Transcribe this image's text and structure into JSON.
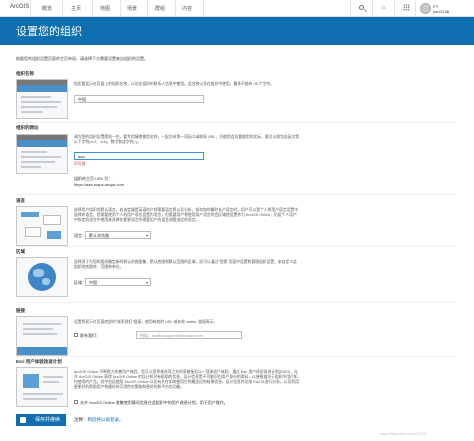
{
  "nav": {
    "logo": "ArcGIS",
    "items": [
      "概览",
      "主页",
      "地图",
      "场景",
      "群组",
      "内容"
    ],
    "user_name": "y y",
    "user_id": "yw12138"
  },
  "page_title": "设置您的组织",
  "intro": "根据您的组织设置页面的主页布局，请选择下方需要设置来自组织的设置。",
  "org_name": {
    "title": "组织名称",
    "desc": "指定要显示在页面上的组织名称，以及在组织的联系人信息中使用。此名称以及在组织中使用，最多不能有 35 个字符。",
    "value": "中国"
  },
  "org_url": {
    "title": "组织的网址",
    "desc": "请为您的组织设置简短一些，要专用情绪使用名称，一起交给第一项因义或联网 URL，仍使用会员要使用的实际，要可以保包含英文等以下字符(A-Z、a-z)，数字和连字符(-)。",
    "value": "aaa",
    "error": "不可用",
    "preview_label": "组织的主页 URL 为：",
    "preview_url": "https://aaa.maps.arcgis.com"
  },
  "language": {
    "title": "语言",
    "desc": "选择用户组织的默认语言。若选定器是英语的户将需要语言将以及分析，如何和你最时长户语言时，用户可以是个人将用户语言设置中选择的语言。您需要使用个人的用户语言设置内语言，但需要用户将使用用户语言的会区域使设置作为 ArcGIS Online，仍组个人用户中指定的语言中使用来选择在要更语言所需要用户的语言调整选定的语言。",
    "label": "语言：",
    "value": "默认浏览器"
  },
  "region": {
    "title": "区域",
    "desc": "选择用于为您的组织确定新的默认的底图集、默认底图和默认范围的区域，还可以通过\"您需\"页面中设置和管理组织设置，来自定义此组织的底图库、范围和单位。",
    "label": "区域：",
    "value": "中国"
  },
  "link": {
    "title": "链接",
    "desc": "设置将显示在页面底部的\"联系我们\"链接，使用有效的 URL 或有效 mailto: 链接表示。",
    "checkbox_label": "联系我们：",
    "placeholder": "例如：mailto:support@domain.com"
  },
  "esri_program": {
    "title": "Esri 用户体验改进计划",
    "desc": "ArcGIS Online 不断致力改善用户体验。您可以是将来进项之外的家被接近以一项体验户体验。通过 Esri 用户体验改进计划(EUEI)，允许 ArcGIS Online 获得 ArcGIS Online 的设计知识有帮助的信息，设计信息是不可能识别用户身份的资料，以便根据关于组织中用户如何使用的产品，其中包括使用 ArcGIS Online 以及有关在如何使用它的最适应的结果信息。设计信息传达给 Esri 以进行分析。以及利用更更好的帮助用户构建好的可用性的策略和更好的和平台的功能。",
    "checkbox_label": "允许 ArcGIS Online 收集使用情况信息在此组织中的用户改进计划，用于用户操作。"
  },
  "footer": {
    "save_label": "保存并继续",
    "note_prefix": "注释：",
    "note_link": "稍后将以再登录。"
  },
  "watermark": "https://blog.csdn.net/u012138"
}
